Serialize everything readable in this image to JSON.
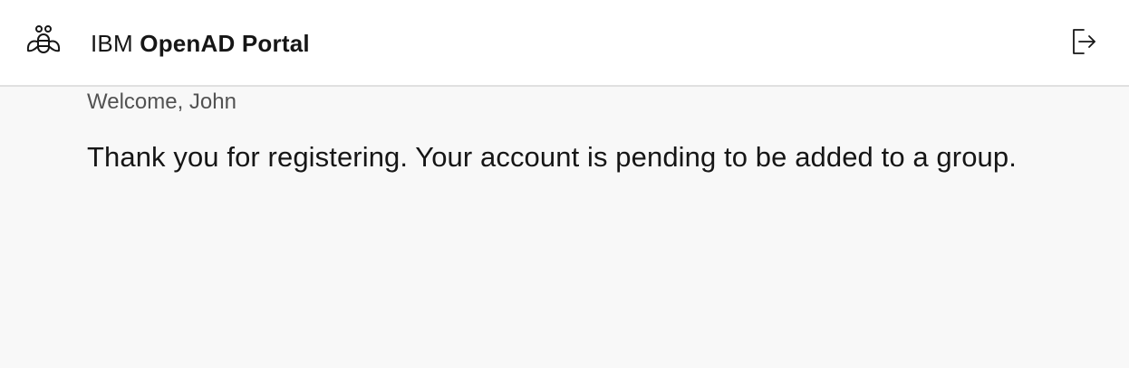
{
  "header": {
    "logo_icon": "bee-icon",
    "brand_prefix": "IBM",
    "brand_name": "OpenAD Portal",
    "logout_icon": "logout-icon"
  },
  "main": {
    "welcome_text": "Welcome, John",
    "message": "Thank you for registering. Your account is pending to be added to a group."
  },
  "colors": {
    "header_bg": "#ffffff",
    "page_bg": "#f8f8f8",
    "text_primary": "#161616",
    "text_secondary": "#525252",
    "divider": "#e0e0e0"
  }
}
